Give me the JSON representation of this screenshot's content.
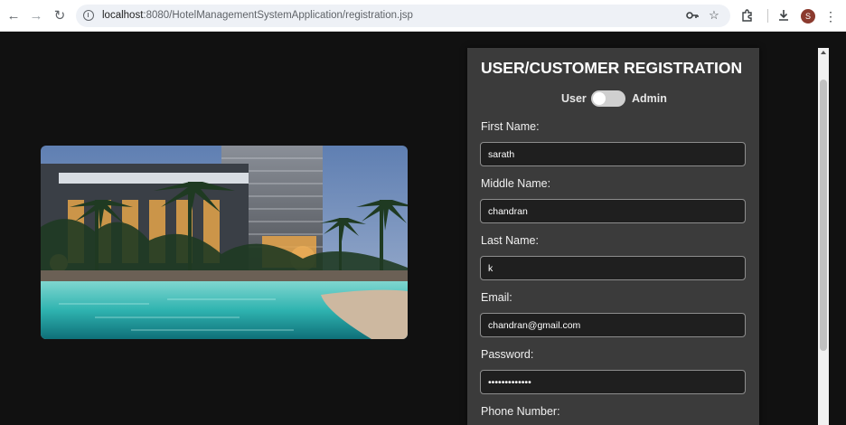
{
  "browser": {
    "url_host": "localhost",
    "url_path": ":8080/HotelManagementSystemApplication/registration.jsp",
    "profile_initial": "S",
    "icons": [
      "back-icon",
      "forward-icon",
      "reload-icon",
      "site-info-icon",
      "password-key-icon",
      "bookmark-star-icon",
      "extensions-icon",
      "download-icon",
      "menu-icon"
    ]
  },
  "page": {
    "hero_image": "hotel-pool-at-dusk",
    "form": {
      "title": "USER/CUSTOMER REGISTRATION",
      "toggle_left_label": "User",
      "toggle_right_label": "Admin",
      "first_name_label": "First Name:",
      "first_name_value": "sarath",
      "middle_name_label": "Middle Name:",
      "middle_name_value": "chandran",
      "last_name_label": "Last Name:",
      "last_name_value": "k",
      "email_label": "Email:",
      "email_value": "chandran@gmail.com",
      "password_label": "Password:",
      "password_value": "•••••••••••••",
      "phone_label": "Phone Number:"
    }
  },
  "colors": {
    "page_background": "#111111",
    "panel_background": "#3b3b3b",
    "input_background": "#1f1f1f"
  }
}
